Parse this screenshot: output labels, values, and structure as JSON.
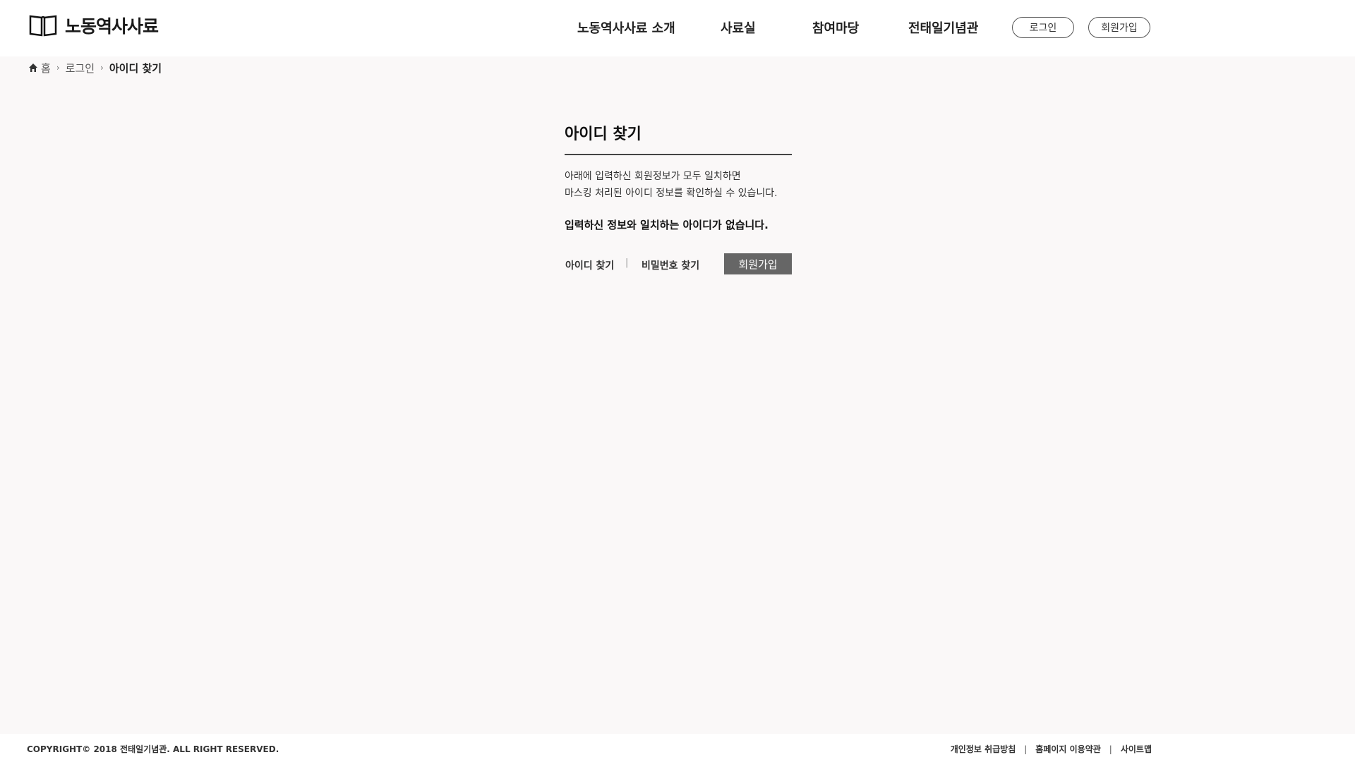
{
  "header": {
    "logo_text": "노동역사사료",
    "nav": [
      "노동역사사료 소개",
      "사료실",
      "참여마당",
      "전태일기념관"
    ],
    "login_label": "로그인",
    "signup_label": "회원가입"
  },
  "breadcrumb": {
    "home": "홈",
    "login": "로그인",
    "current": "아이디 찾기"
  },
  "main": {
    "title": "아이디 찾기",
    "desc_line1": "아래에 입력하신 회원정보가 모두 일치하면",
    "desc_line2": "마스킹 처리된 아이디 정보를 확인하실 수 있습니다.",
    "result_message": "입력하신 정보와 일치하는 아이디가 없습니다.",
    "find_id_label": "아이디 찾기",
    "separator": "|",
    "find_pw_label": "비밀번호 찾기",
    "join_label": "회원가입"
  },
  "footer": {
    "copyright": "COPYRIGHT© 2018 전태일기념관.  ALL RIGHT RESERVED.",
    "links": [
      "개인정보 취급방침",
      "홈페이지 이용약관",
      "사이트맵"
    ],
    "separator": "|"
  },
  "colors": {
    "background": "#faf8f8",
    "button_bg": "#666666",
    "text": "#222222"
  },
  "icons": {
    "logo": "open-book-icon",
    "home": "home-icon",
    "breadcrumb_sep": "chevron-right-icon"
  }
}
